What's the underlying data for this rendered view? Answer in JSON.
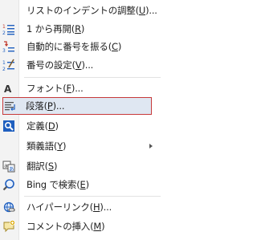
{
  "menu": {
    "items": [
      {
        "label": "リストのインデントの調整(U)..."
      },
      {
        "label": "1 から再開(R)"
      },
      {
        "label": "自動的に番号を振る(C)"
      },
      {
        "label": "番号の設定(V)..."
      },
      {
        "label": "フォント(F)..."
      },
      {
        "label": "段落(P)..."
      },
      {
        "label": "定義(D)"
      },
      {
        "label": "類義語(Y)"
      },
      {
        "label": "翻訳(S)"
      },
      {
        "label": "Bing で検索(E)"
      },
      {
        "label": "ハイパーリンク(H)..."
      },
      {
        "label": "コメントの挿入(M)"
      }
    ],
    "highlight_border_color": "#c73a3a",
    "highlight_fill_color": "#dfe7f2",
    "accent_color": "#1f5fbf"
  }
}
